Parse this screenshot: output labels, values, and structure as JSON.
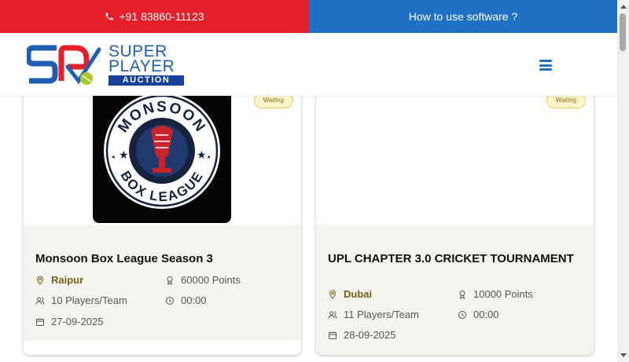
{
  "topbar": {
    "phone": "+91 83860-11123",
    "help_link": "How to use software ?"
  },
  "logo": {
    "line1": "SUPER",
    "line2": "PLAYER",
    "line3": "AUCTION"
  },
  "colors": {
    "phone_bar": "#e5202a",
    "help_bar": "#1f71c5",
    "city_text": "#7a5c14",
    "badge_bg": "#fff5cc"
  },
  "cards": [
    {
      "status": "Waiting",
      "logo_top": "MONSOON",
      "logo_bottom": "BOX LEAGUE",
      "title": "Monsoon Box League Season 3",
      "city": "Raipur",
      "points": "60000 Points",
      "players": "10 Players/Team",
      "time": "00:00",
      "date": "27-09-2025"
    },
    {
      "status": "Waiting",
      "title": "UPL CHAPTER 3.0 CRICKET TOURNAMENT",
      "city": "Dubai",
      "points": "10000 Points",
      "players": "11 Players/Team",
      "time": "00:00",
      "date": "28-09-2025"
    }
  ],
  "icons": [
    "phone-icon",
    "menu-icon",
    "location-icon",
    "award-icon",
    "users-icon",
    "clock-icon",
    "calendar-icon"
  ]
}
